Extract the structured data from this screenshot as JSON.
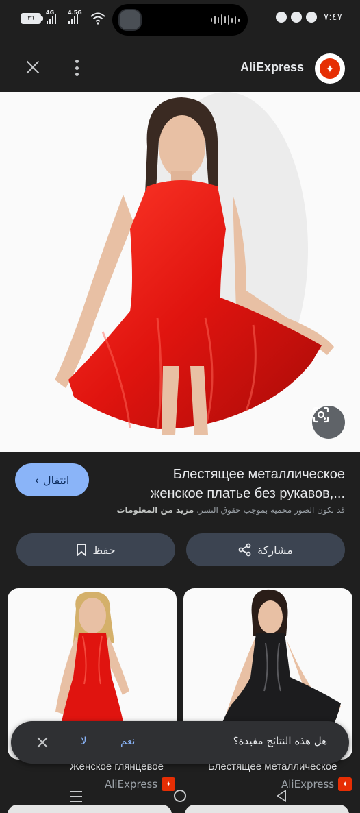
{
  "status_bar": {
    "time": "٧:٤٧",
    "battery": "٣٦",
    "network_1": "4G",
    "network_2": "4.5G"
  },
  "app_bar": {
    "site_name": "AliExpress"
  },
  "hero": {
    "dress_color": "#e0140f"
  },
  "info": {
    "visit_label": "انتقال",
    "title": "Блестящее металлическое женское платье без рукавов,...",
    "copyright_text": "قد تكون الصور محمية بموجب حقوق النشر.",
    "learn_more": "مزيد من المعلومات",
    "save_label": "حفظ",
    "share_label": "مشاركة"
  },
  "related": [
    {
      "title": "Женское глянцевое",
      "source": "AliExpress",
      "dress_color": "#e0140f"
    },
    {
      "title": "Блестящее металлическое",
      "source": "AliExpress",
      "dress_color": "#1c1c1e"
    }
  ],
  "feedback": {
    "question": "هل هذه النتائج مفيدة؟",
    "yes": "نعم",
    "no": "لا"
  },
  "colors": {
    "background": "#1f1f1f",
    "accent": "#8ab4f8",
    "pill": "#3c4451",
    "brand": "#e62e04"
  }
}
